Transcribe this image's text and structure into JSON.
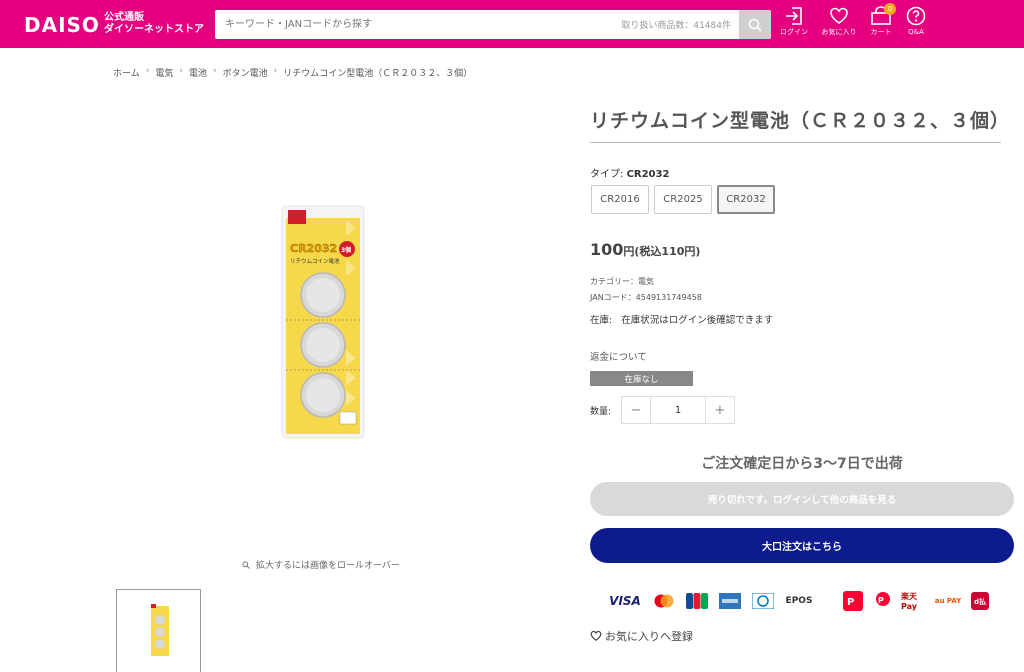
{
  "header": {
    "logo": "DAISO",
    "logo_sub_line1": "公式通販",
    "logo_sub_line2": "ダイソーネットストア",
    "search_placeholder": "キーワード・JANコードから探す",
    "item_count": "取り扱い商品数：41484件",
    "icons": [
      {
        "name": "login-icon",
        "label": "ログイン"
      },
      {
        "name": "heart-icon",
        "label": "お気に入り"
      },
      {
        "name": "cart-icon",
        "label": "カート",
        "badge": "0"
      },
      {
        "name": "help-icon",
        "label": "Q&A"
      }
    ]
  },
  "breadcrumb": [
    "ホーム",
    "電気",
    "電池",
    "ボタン電池",
    "リチウムコイン型電池（ＣＲ２０３２、３個）"
  ],
  "product": {
    "title": "リチウムコイン型電池（ＣＲ２０３２、３個）",
    "type_label": "タイプ:",
    "type_value": "CR2032",
    "variants": [
      "CR2016",
      "CR2025",
      "CR2032"
    ],
    "selected_variant": "CR2032",
    "price": "100",
    "price_suffix": "円(税込110円)",
    "category": "カテゴリー：電気",
    "jan": "JANコード：4549131749458",
    "stock_label": "在庫:",
    "stock_text": "在庫状況はログイン後確認できます",
    "refund": "返金について",
    "oos_badge": "在庫なし",
    "qty_label": "数量:",
    "qty_value": "1",
    "qty_minus": "−",
    "qty_plus": "+",
    "ship_note": "ご注文確定日から3〜7日で出荷",
    "soldout_button": "売り切れです。ログインして他の商品を見る",
    "bulk_button": "大口注文はこちら",
    "favorite_link": "お気に入りへ登録",
    "zoom_hint": "拡大するには画像をロールオーバー",
    "package_text": {
      "model": "CR2032",
      "count": "3個",
      "name": "リチウムコイン電池"
    }
  },
  "payments": [
    "VISA",
    "Mastercard",
    "JCB",
    "AMEX",
    "Diners",
    "EPOS",
    "PayPay",
    "d払い",
    "楽天Pay",
    "au PAY",
    "d払い"
  ],
  "colors": {
    "brand": "#e4007f",
    "bulk_button": "#0e1b8e",
    "soldout_button": "#d9d9d9"
  }
}
